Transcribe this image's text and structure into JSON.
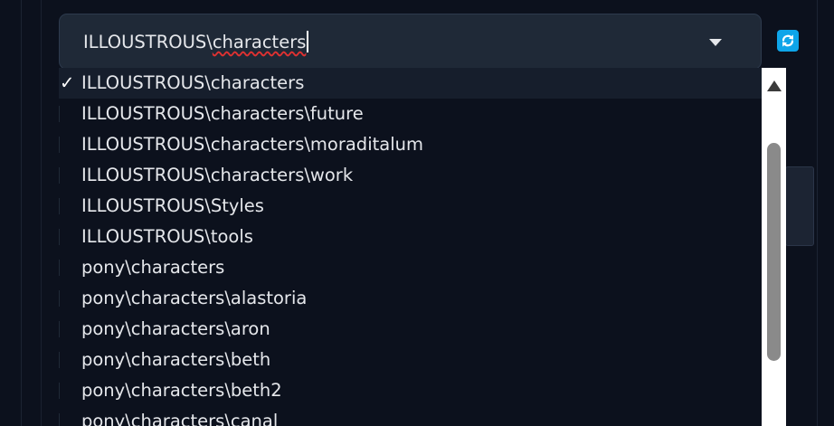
{
  "dropdown": {
    "input_value_prefix": "ILLOUSTROUS\\",
    "input_value_misspelled": "characters",
    "options": [
      {
        "label": "ILLOUSTROUS\\characters",
        "selected": true,
        "check": "✓"
      },
      {
        "label": "ILLOUSTROUS\\characters\\future",
        "selected": false
      },
      {
        "label": "ILLOUSTROUS\\characters\\moraditalum",
        "selected": false
      },
      {
        "label": "ILLOUSTROUS\\characters\\work",
        "selected": false
      },
      {
        "label": "ILLOUSTROUS\\Styles",
        "selected": false
      },
      {
        "label": "ILLOUSTROUS\\tools",
        "selected": false
      },
      {
        "label": "pony\\characters",
        "selected": false
      },
      {
        "label": "pony\\characters\\alastoria",
        "selected": false
      },
      {
        "label": "pony\\characters\\aron",
        "selected": false
      },
      {
        "label": "pony\\characters\\beth",
        "selected": false
      },
      {
        "label": "pony\\characters\\beth2",
        "selected": false
      },
      {
        "label": "pony\\characters\\canal",
        "selected": false
      }
    ]
  },
  "icons": {
    "expand": "chevron-down-icon",
    "refresh": "refresh-icon",
    "selected_mark": "checkmark-icon",
    "scroll_up": "scroll-up-arrow-icon"
  },
  "colors": {
    "background": "#0c111d",
    "input_background": "#1f2937",
    "accent": "#0ea5e9",
    "text": "#e5e7eb",
    "spellcheck_underline": "#e03131",
    "selected_row": "#161e2c"
  }
}
